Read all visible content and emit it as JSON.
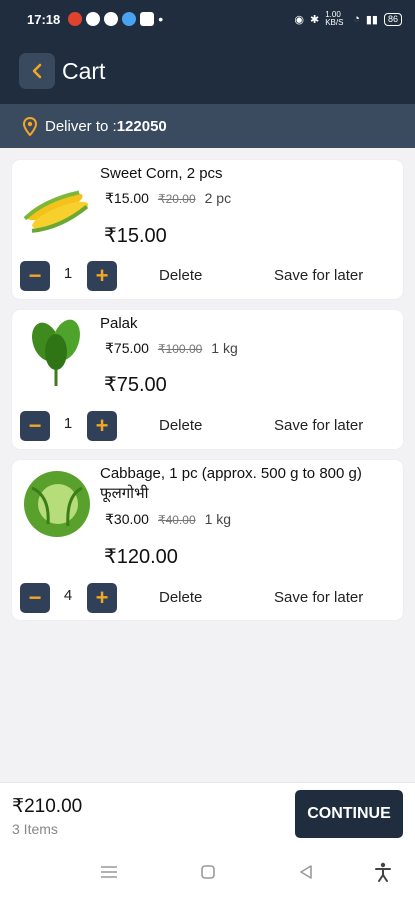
{
  "status_bar": {
    "time": "17:18",
    "network": "1.00 KB/S",
    "battery": "86"
  },
  "header": {
    "title": "Cart"
  },
  "delivery": {
    "label": "Deliver to : ",
    "pincode": "122050"
  },
  "items": [
    {
      "name": "Sweet Corn, 2 pcs",
      "price": "₹15.00",
      "mrp": "₹20.00",
      "unit": "2 pc",
      "line_total": "₹15.00",
      "qty": "1",
      "image": "corn"
    },
    {
      "name": "Palak",
      "price": "₹75.00",
      "mrp": "₹100.00",
      "unit": "1 kg",
      "line_total": "₹75.00",
      "qty": "1",
      "image": "spinach"
    },
    {
      "name": "Cabbage, 1 pc (approx. 500 g to 800 g) फूलगोभी",
      "price": "₹30.00",
      "mrp": "₹40.00",
      "unit": "1 kg",
      "line_total": "₹120.00",
      "qty": "4",
      "image": "cabbage"
    }
  ],
  "labels": {
    "delete": "Delete",
    "save_for_later": "Save for later",
    "minus": "−",
    "plus": "+"
  },
  "footer": {
    "total": "₹210.00",
    "count": "3 Items",
    "continue": "CONTINUE"
  },
  "colors": {
    "primary": "#1f2d3f",
    "accent": "#f5a623",
    "deliver_bar": "#3a4b60"
  }
}
